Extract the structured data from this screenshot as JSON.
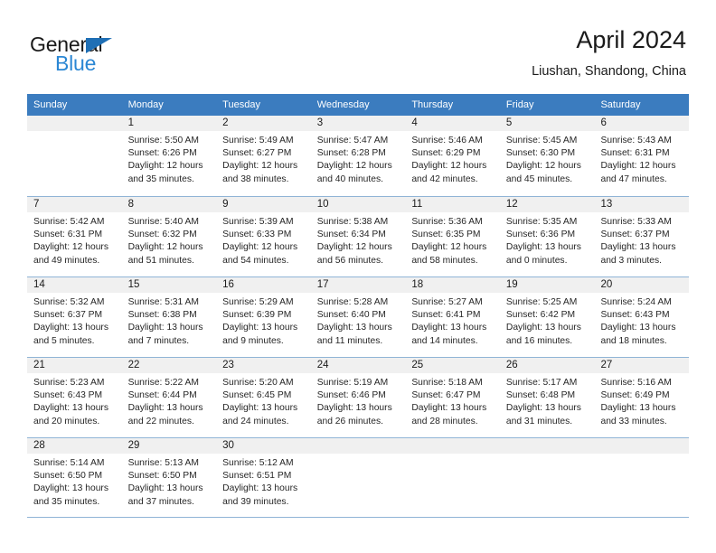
{
  "brand": {
    "name_part1": "General",
    "name_part2": "Blue",
    "triangle_icon": "triangle-icon",
    "accent_dark": "#1f6fb5",
    "accent_light": "#2b87d4"
  },
  "header": {
    "title": "April 2024",
    "subtitle": "Liushan, Shandong, China"
  },
  "theme": {
    "header_row_bg": "#3b7cbf",
    "daynum_bg": "#f0f0f0",
    "grid_line": "#8fb4d6"
  },
  "weekdays": [
    "Sunday",
    "Monday",
    "Tuesday",
    "Wednesday",
    "Thursday",
    "Friday",
    "Saturday"
  ],
  "weeks": [
    [
      {
        "day": "",
        "sunrise": "",
        "sunset": "",
        "daylight_line1": "",
        "daylight_line2": ""
      },
      {
        "day": "1",
        "sunrise": "Sunrise: 5:50 AM",
        "sunset": "Sunset: 6:26 PM",
        "daylight_line1": "Daylight: 12 hours",
        "daylight_line2": "and 35 minutes."
      },
      {
        "day": "2",
        "sunrise": "Sunrise: 5:49 AM",
        "sunset": "Sunset: 6:27 PM",
        "daylight_line1": "Daylight: 12 hours",
        "daylight_line2": "and 38 minutes."
      },
      {
        "day": "3",
        "sunrise": "Sunrise: 5:47 AM",
        "sunset": "Sunset: 6:28 PM",
        "daylight_line1": "Daylight: 12 hours",
        "daylight_line2": "and 40 minutes."
      },
      {
        "day": "4",
        "sunrise": "Sunrise: 5:46 AM",
        "sunset": "Sunset: 6:29 PM",
        "daylight_line1": "Daylight: 12 hours",
        "daylight_line2": "and 42 minutes."
      },
      {
        "day": "5",
        "sunrise": "Sunrise: 5:45 AM",
        "sunset": "Sunset: 6:30 PM",
        "daylight_line1": "Daylight: 12 hours",
        "daylight_line2": "and 45 minutes."
      },
      {
        "day": "6",
        "sunrise": "Sunrise: 5:43 AM",
        "sunset": "Sunset: 6:31 PM",
        "daylight_line1": "Daylight: 12 hours",
        "daylight_line2": "and 47 minutes."
      }
    ],
    [
      {
        "day": "7",
        "sunrise": "Sunrise: 5:42 AM",
        "sunset": "Sunset: 6:31 PM",
        "daylight_line1": "Daylight: 12 hours",
        "daylight_line2": "and 49 minutes."
      },
      {
        "day": "8",
        "sunrise": "Sunrise: 5:40 AM",
        "sunset": "Sunset: 6:32 PM",
        "daylight_line1": "Daylight: 12 hours",
        "daylight_line2": "and 51 minutes."
      },
      {
        "day": "9",
        "sunrise": "Sunrise: 5:39 AM",
        "sunset": "Sunset: 6:33 PM",
        "daylight_line1": "Daylight: 12 hours",
        "daylight_line2": "and 54 minutes."
      },
      {
        "day": "10",
        "sunrise": "Sunrise: 5:38 AM",
        "sunset": "Sunset: 6:34 PM",
        "daylight_line1": "Daylight: 12 hours",
        "daylight_line2": "and 56 minutes."
      },
      {
        "day": "11",
        "sunrise": "Sunrise: 5:36 AM",
        "sunset": "Sunset: 6:35 PM",
        "daylight_line1": "Daylight: 12 hours",
        "daylight_line2": "and 58 minutes."
      },
      {
        "day": "12",
        "sunrise": "Sunrise: 5:35 AM",
        "sunset": "Sunset: 6:36 PM",
        "daylight_line1": "Daylight: 13 hours",
        "daylight_line2": "and 0 minutes."
      },
      {
        "day": "13",
        "sunrise": "Sunrise: 5:33 AM",
        "sunset": "Sunset: 6:37 PM",
        "daylight_line1": "Daylight: 13 hours",
        "daylight_line2": "and 3 minutes."
      }
    ],
    [
      {
        "day": "14",
        "sunrise": "Sunrise: 5:32 AM",
        "sunset": "Sunset: 6:37 PM",
        "daylight_line1": "Daylight: 13 hours",
        "daylight_line2": "and 5 minutes."
      },
      {
        "day": "15",
        "sunrise": "Sunrise: 5:31 AM",
        "sunset": "Sunset: 6:38 PM",
        "daylight_line1": "Daylight: 13 hours",
        "daylight_line2": "and 7 minutes."
      },
      {
        "day": "16",
        "sunrise": "Sunrise: 5:29 AM",
        "sunset": "Sunset: 6:39 PM",
        "daylight_line1": "Daylight: 13 hours",
        "daylight_line2": "and 9 minutes."
      },
      {
        "day": "17",
        "sunrise": "Sunrise: 5:28 AM",
        "sunset": "Sunset: 6:40 PM",
        "daylight_line1": "Daylight: 13 hours",
        "daylight_line2": "and 11 minutes."
      },
      {
        "day": "18",
        "sunrise": "Sunrise: 5:27 AM",
        "sunset": "Sunset: 6:41 PM",
        "daylight_line1": "Daylight: 13 hours",
        "daylight_line2": "and 14 minutes."
      },
      {
        "day": "19",
        "sunrise": "Sunrise: 5:25 AM",
        "sunset": "Sunset: 6:42 PM",
        "daylight_line1": "Daylight: 13 hours",
        "daylight_line2": "and 16 minutes."
      },
      {
        "day": "20",
        "sunrise": "Sunrise: 5:24 AM",
        "sunset": "Sunset: 6:43 PM",
        "daylight_line1": "Daylight: 13 hours",
        "daylight_line2": "and 18 minutes."
      }
    ],
    [
      {
        "day": "21",
        "sunrise": "Sunrise: 5:23 AM",
        "sunset": "Sunset: 6:43 PM",
        "daylight_line1": "Daylight: 13 hours",
        "daylight_line2": "and 20 minutes."
      },
      {
        "day": "22",
        "sunrise": "Sunrise: 5:22 AM",
        "sunset": "Sunset: 6:44 PM",
        "daylight_line1": "Daylight: 13 hours",
        "daylight_line2": "and 22 minutes."
      },
      {
        "day": "23",
        "sunrise": "Sunrise: 5:20 AM",
        "sunset": "Sunset: 6:45 PM",
        "daylight_line1": "Daylight: 13 hours",
        "daylight_line2": "and 24 minutes."
      },
      {
        "day": "24",
        "sunrise": "Sunrise: 5:19 AM",
        "sunset": "Sunset: 6:46 PM",
        "daylight_line1": "Daylight: 13 hours",
        "daylight_line2": "and 26 minutes."
      },
      {
        "day": "25",
        "sunrise": "Sunrise: 5:18 AM",
        "sunset": "Sunset: 6:47 PM",
        "daylight_line1": "Daylight: 13 hours",
        "daylight_line2": "and 28 minutes."
      },
      {
        "day": "26",
        "sunrise": "Sunrise: 5:17 AM",
        "sunset": "Sunset: 6:48 PM",
        "daylight_line1": "Daylight: 13 hours",
        "daylight_line2": "and 31 minutes."
      },
      {
        "day": "27",
        "sunrise": "Sunrise: 5:16 AM",
        "sunset": "Sunset: 6:49 PM",
        "daylight_line1": "Daylight: 13 hours",
        "daylight_line2": "and 33 minutes."
      }
    ],
    [
      {
        "day": "28",
        "sunrise": "Sunrise: 5:14 AM",
        "sunset": "Sunset: 6:50 PM",
        "daylight_line1": "Daylight: 13 hours",
        "daylight_line2": "and 35 minutes."
      },
      {
        "day": "29",
        "sunrise": "Sunrise: 5:13 AM",
        "sunset": "Sunset: 6:50 PM",
        "daylight_line1": "Daylight: 13 hours",
        "daylight_line2": "and 37 minutes."
      },
      {
        "day": "30",
        "sunrise": "Sunrise: 5:12 AM",
        "sunset": "Sunset: 6:51 PM",
        "daylight_line1": "Daylight: 13 hours",
        "daylight_line2": "and 39 minutes."
      },
      {
        "day": "",
        "sunrise": "",
        "sunset": "",
        "daylight_line1": "",
        "daylight_line2": ""
      },
      {
        "day": "",
        "sunrise": "",
        "sunset": "",
        "daylight_line1": "",
        "daylight_line2": ""
      },
      {
        "day": "",
        "sunrise": "",
        "sunset": "",
        "daylight_line1": "",
        "daylight_line2": ""
      },
      {
        "day": "",
        "sunrise": "",
        "sunset": "",
        "daylight_line1": "",
        "daylight_line2": ""
      }
    ]
  ]
}
